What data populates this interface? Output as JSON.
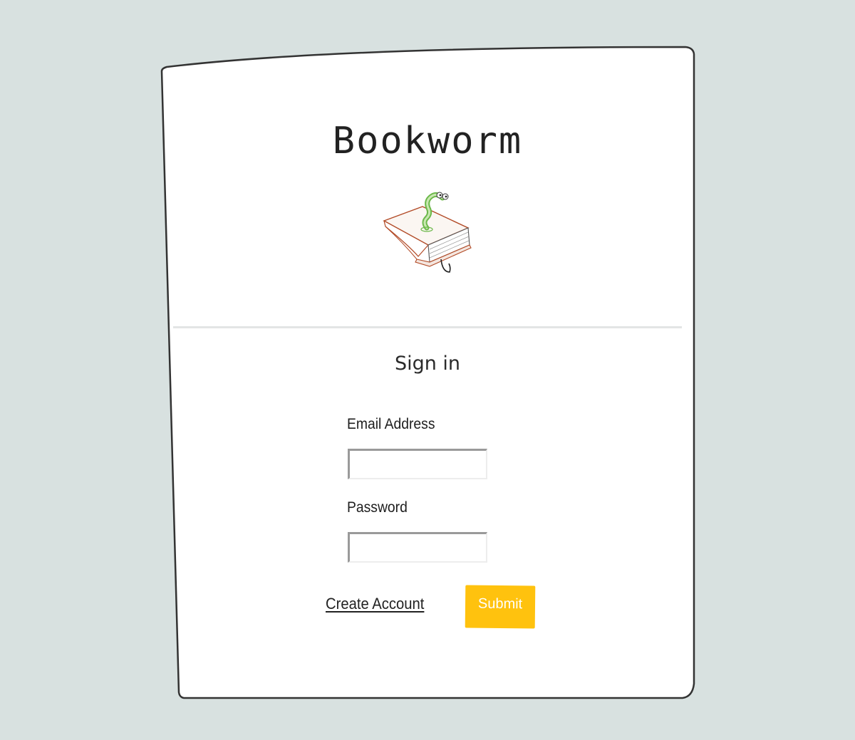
{
  "app": {
    "title": "Bookworm"
  },
  "logo": {
    "icon": "bookworm-logo-icon"
  },
  "signin": {
    "heading": "Sign in",
    "email_label": "Email Address",
    "email_value": "",
    "password_label": "Password",
    "password_value": "",
    "create_account_label": "Create Account",
    "submit_label": "Submit"
  },
  "colors": {
    "background": "#d8e1e0",
    "card": "#ffffff",
    "card_border": "#333333",
    "accent": "#ffc20e",
    "divider": "#e3e5e5"
  }
}
